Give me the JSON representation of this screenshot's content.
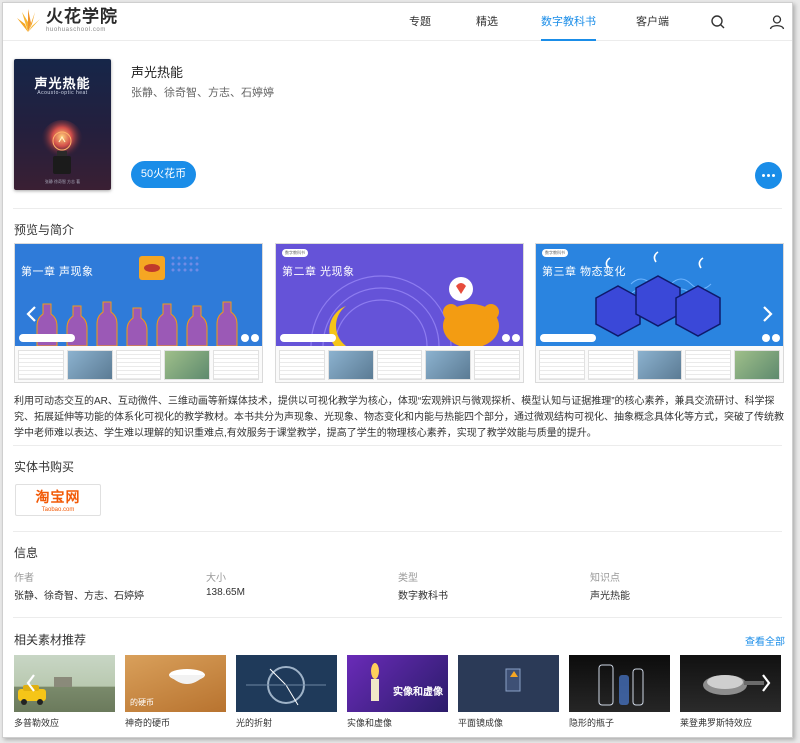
{
  "header": {
    "logo_name": "火花学院",
    "logo_domain": "huohuaschool.com",
    "nav": [
      "专题",
      "精选",
      "数字教科书",
      "客户端"
    ]
  },
  "book": {
    "title": "声光热能",
    "authors": "张静、徐奇智、方志、石婷婷",
    "price": "50火花币",
    "cover_title": "声光热能",
    "cover_subtitle": "Acousto-optic heat",
    "cover_authors": "张静 徐奇智 方志 著"
  },
  "preview": {
    "title": "预览与简介",
    "slides": [
      {
        "chapter": "第一章 声现象",
        "tag": "",
        "bg": "#2f7bd9"
      },
      {
        "chapter": "第二章 光现象",
        "tag": "数字教科书",
        "bg": "#6553d8"
      },
      {
        "chapter": "第三章 物态变化",
        "tag": "数字教科书",
        "bg": "#2a84e0"
      }
    ],
    "intro": "利用可动态交互的AR、互动微件、三维动画等新媒体技术，提供以可视化教学为核心，体现“宏观辨识与微观探析、模型认知与证据推理”的核心素养，兼具交流研讨、科学探究、拓展延伸等功能的体系化可视化的教学教材。本书共分为声现象、光现象、物态变化和内能与热能四个部分，通过微观结构可视化、抽象概念具体化等方式，突破了传统教学中老师难以表达、学生难以理解的知识重难点,有效服务于课堂教学，提高了学生的物理核心素养，实现了教学效能与质量的提升。"
  },
  "purchase": {
    "title": "实体书购买",
    "store_cn": "淘宝网",
    "store_en": "Taobao.com"
  },
  "info": {
    "title": "信息",
    "fields": [
      {
        "label": "作者",
        "value": "张静、徐奇智、方志、石婷婷"
      },
      {
        "label": "大小",
        "value": "138.65M"
      },
      {
        "label": "类型",
        "value": "数字教科书"
      },
      {
        "label": "知识点",
        "value": "声光热能"
      }
    ]
  },
  "related": {
    "title": "相关素材推荐",
    "view_all": "查看全部",
    "items": [
      {
        "label": "多普勒效应",
        "overlay": ""
      },
      {
        "label": "神奇的硬币",
        "overlay": "的硬币"
      },
      {
        "label": "光的折射",
        "overlay": ""
      },
      {
        "label": "实像和虚像",
        "overlay": "实像和虚像"
      },
      {
        "label": "平面镜成像",
        "overlay": ""
      },
      {
        "label": "隐形的瓶子",
        "overlay": ""
      },
      {
        "label": "莱登弗罗斯特效应",
        "overlay": ""
      }
    ]
  },
  "colors": {
    "accent": "#1a8de8",
    "taobao": "#f25a07"
  }
}
